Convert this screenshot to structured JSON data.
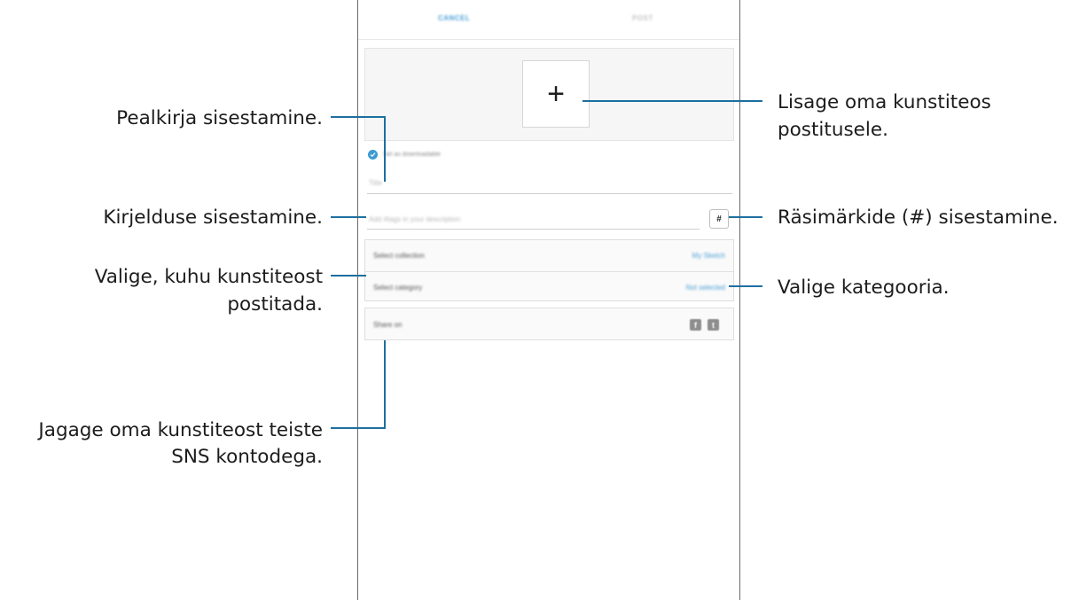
{
  "app": {
    "cancel_label": "CANCEL",
    "post_label": "POST",
    "add_artwork_symbol": "+",
    "download_label": "Set as downloadable",
    "title_placeholder": "Title",
    "description_placeholder": "Add #tags in your description",
    "hashtag_symbol": "#",
    "select_collection_label": "Select collection",
    "select_collection_value": "My Sketch",
    "select_category_label": "Select category",
    "select_category_value": "Not selected",
    "share_on_label": "Share on",
    "facebook_glyph": "f",
    "twitter_glyph": "t"
  },
  "callouts": {
    "title_entry": "Pealkirja sisestamine.",
    "description_entry": "Kirjelduse sisestamine.",
    "collection_line1": "Valige, kuhu kunstiteost",
    "collection_line2": "postitada.",
    "share_line1": "Jagage oma kunstiteost teiste",
    "share_line2": "SNS kontodega.",
    "artwork_line1": "Lisage oma kunstiteos",
    "artwork_line2": "postitusele.",
    "hashtags": "Räsimärkide (#) sisestamine.",
    "category": "Valige kategooria."
  },
  "colors": {
    "accent": "#4a9fd6",
    "callout_line": "#1e6f9f"
  }
}
